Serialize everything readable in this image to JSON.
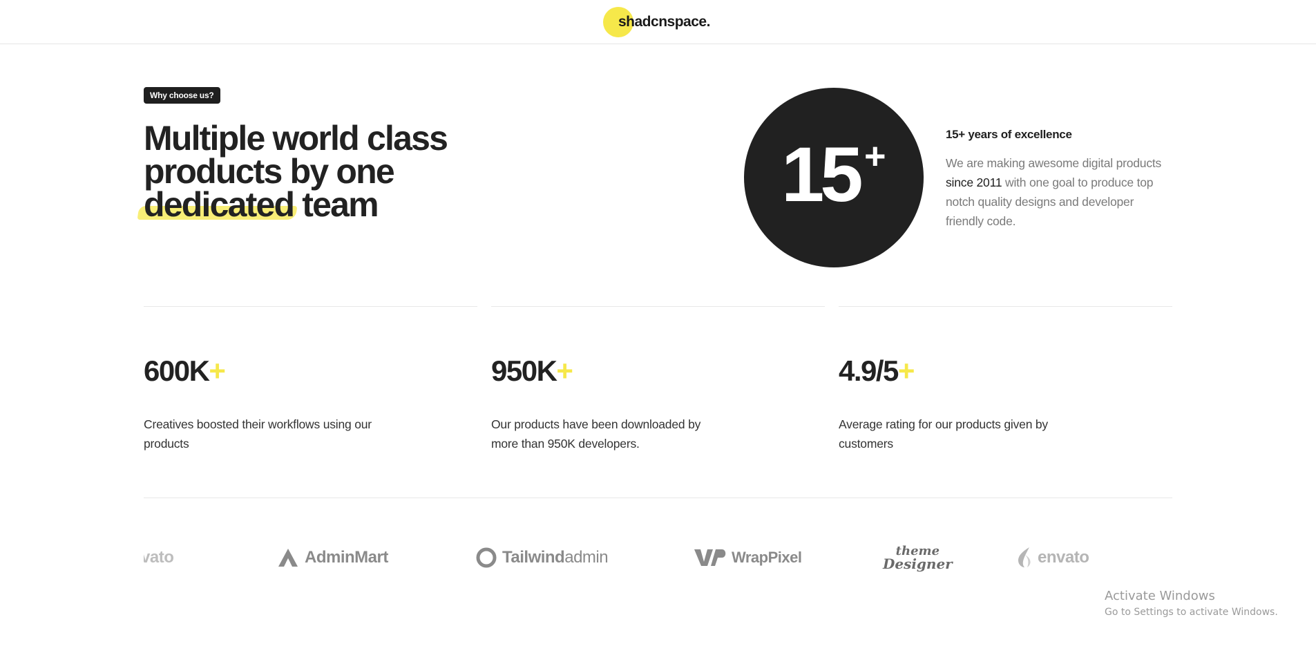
{
  "header": {
    "logo_text": "shadcnspace."
  },
  "hero": {
    "badge": "Why choose us?",
    "headline_line1": "Multiple world class",
    "headline_line2": "products by one",
    "headline_highlight": "dedicated",
    "headline_tail": " team"
  },
  "excellence": {
    "number": "15",
    "plus": "+",
    "title": "15+ years of excellence",
    "desc_start": "We are making awesome digital products ",
    "desc_emph": "since 2011",
    "desc_end": " with one goal to produce top notch quality designs and developer friendly code."
  },
  "stats": [
    {
      "value": "600K",
      "plus": "+",
      "desc": "Creatives boosted their workflows using our products"
    },
    {
      "value": "950K",
      "plus": "+",
      "desc": "Our products have been downloaded by more than 950K developers."
    },
    {
      "value": "4.9/5",
      "plus": "+",
      "desc": "Average rating for our products given by customers"
    }
  ],
  "brands": {
    "envato_partial": "vato",
    "adminmart": "AdminMart",
    "tailwind_bold": "Tailwind",
    "tailwind_light": "admin",
    "wrappixel": "WrapPixel",
    "theme_designer_1": "theme",
    "theme_designer_2": "Designer",
    "envato": "envato"
  },
  "watermark": {
    "title": "Activate Windows",
    "subtitle": "Go to Settings to activate Windows."
  },
  "colors": {
    "accent": "#f6e84a",
    "dark": "#212121",
    "muted": "#7a7a7a"
  }
}
